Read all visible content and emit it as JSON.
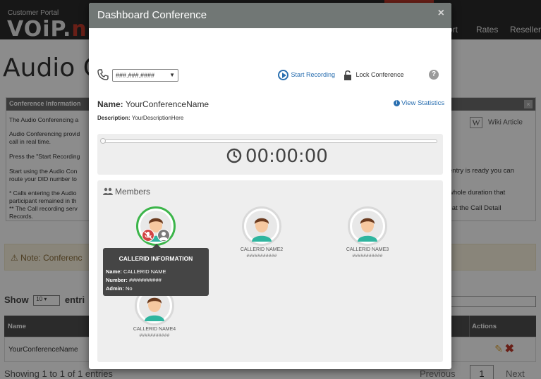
{
  "background": {
    "portal_label": "Customer Portal",
    "logo_text": "VOiP.",
    "logo_suffix": "n",
    "nav": {
      "support": "ort",
      "rates": "Rates",
      "reseller": "Reseller"
    },
    "page_title": "Audio C",
    "info_panel": {
      "title": "Conference Information",
      "lines": [
        "The Audio Conferencing a",
        "Audio Conferencing provid",
        "call in real time.",
        "Press the \"Start Recording",
        "Start using the Audio Con",
        "route your DID number to",
        "* Calls entering the Audio",
        "participant remained in th",
        "** The Call recording serv",
        "Records."
      ],
      "wiki_label": "Wiki Article",
      "right_lines": [
        "entry is ready you can",
        "whole duration that",
        "l at the Call Detail"
      ]
    },
    "note_text": "Note: Conferenc",
    "show_label": "Show",
    "show_value": "10",
    "entries_label": "entri",
    "table": {
      "col_name": "Name",
      "col_actions": "Actions",
      "row_name": "YourConferenceName"
    },
    "footer_info": "Showing 1 to 1 of 1 entries",
    "pagination": {
      "prev": "Previous",
      "page": "1",
      "next": "Next"
    }
  },
  "modal": {
    "title": "Dashboard Conference",
    "close_symbol": "×",
    "phone_select_value": "###.###.####",
    "start_recording_label": "Start Recording",
    "lock_conference_label": "Lock Conference",
    "help_symbol": "?",
    "name_label": "Name:",
    "name_value": "YourConferenceName",
    "description_label": "Description:",
    "description_value": "YourDescriptionHere",
    "view_statistics_label": "View Statistics",
    "timer": "00:00:00",
    "timer_progress": 0,
    "members_title": "Members",
    "members": [
      {
        "name": "CALLERID NAME",
        "number": "###########",
        "active": true,
        "muted": true,
        "admin": true
      },
      {
        "name": "CALLERID NAME2",
        "number": "###########",
        "active": false
      },
      {
        "name": "CALLERID NAME3",
        "number": "###########",
        "active": false
      },
      {
        "name": "CALLERID NAME4",
        "number": "###########",
        "active": false
      }
    ],
    "tooltip": {
      "title": "CALLERID INFORMATION",
      "name_label": "Name:",
      "name_value": "CALLERID NAME",
      "number_label": "Number:",
      "number_value": "###########",
      "admin_label": "Admin:",
      "admin_value": "No"
    }
  },
  "colors": {
    "modal_header": "#717775",
    "link": "#2a6fb0",
    "active_ring": "#3cb54a",
    "mute_badge": "#d24444",
    "tooltip_bg": "#454545"
  }
}
